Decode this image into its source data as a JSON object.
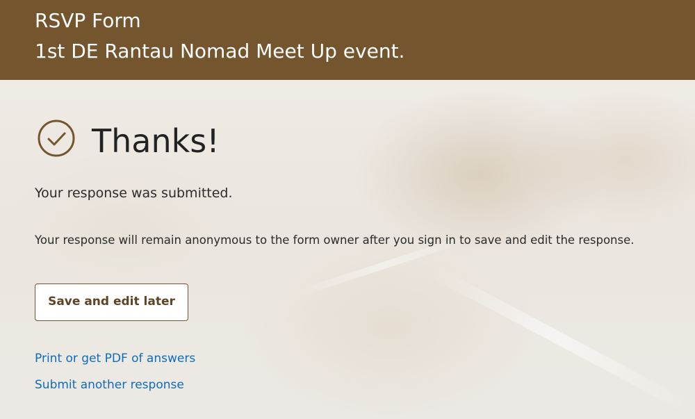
{
  "header": {
    "form_title": "RSVP Form",
    "event_title": "1st DE Rantau Nomad Meet Up event."
  },
  "confirmation": {
    "icon": "check-circle-icon",
    "heading": "Thanks!",
    "submitted_text": "Your response was submitted.",
    "anonymous_text": "Your response will remain anonymous to the form owner after you sign in to save and edit the response."
  },
  "actions": {
    "save_label": "Save and edit later",
    "print_label": "Print or get PDF of answers",
    "another_label": "Submit another response"
  },
  "colors": {
    "brand": "#75552e",
    "link": "#0f6cbd",
    "background": "#ece8e2"
  }
}
